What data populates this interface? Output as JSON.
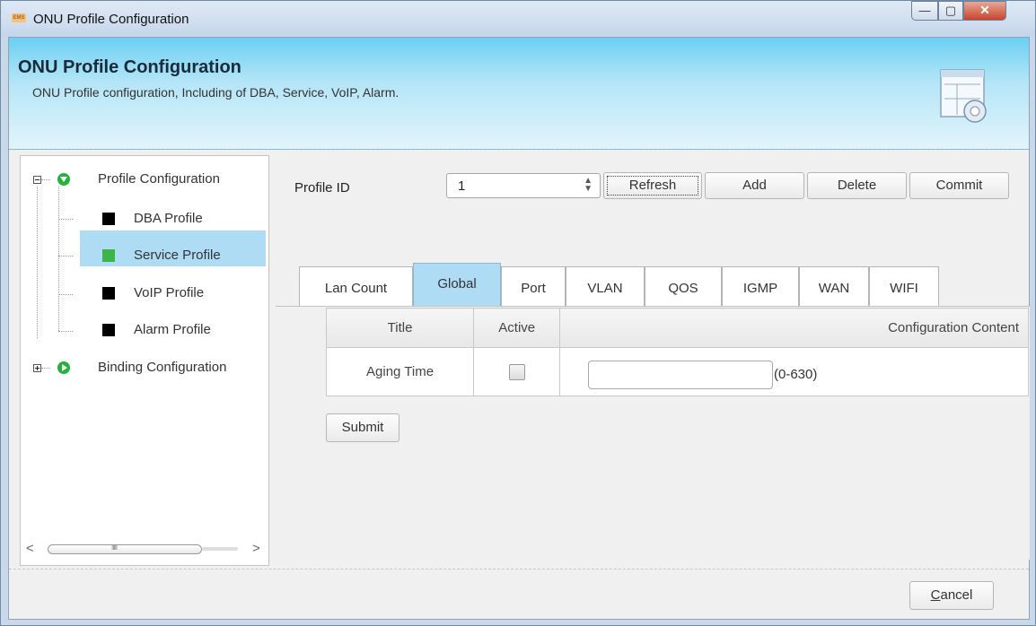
{
  "window": {
    "app_icon_text": "EMS",
    "title": "ONU Profile Configuration",
    "controls": {
      "minimize": "—",
      "maximize": "▢",
      "close": "✕"
    }
  },
  "banner": {
    "title": "ONU Profile Configuration",
    "subtitle": "ONU Profile configuration, Including of DBA, Service, VoIP, Alarm.",
    "icon": "settings-window-icon"
  },
  "tree": {
    "root": {
      "label": "Profile Configuration",
      "expanded": true
    },
    "children": [
      {
        "label": "DBA Profile",
        "color": "#000000"
      },
      {
        "label": "Service Profile",
        "color": "#3cb44a",
        "selected": true
      },
      {
        "label": "VoIP Profile",
        "color": "#000000"
      },
      {
        "label": "Alarm Profile",
        "color": "#000000"
      }
    ],
    "binding": {
      "label": "Binding Configuration",
      "expanded": false
    },
    "scrollbar": {
      "left": "<",
      "right": ">",
      "grip": "IIIII"
    }
  },
  "toolbar": {
    "profile_id_label": "Profile ID",
    "profile_id_value": "1",
    "spin_up": "▲",
    "spin_down": "▼",
    "refresh": "Refresh",
    "add": "Add",
    "delete": "Delete",
    "commit": "Commit"
  },
  "tabs": [
    "Lan Count",
    "Global",
    "Port",
    "VLAN",
    "QOS",
    "IGMP",
    "WAN",
    "WIFI"
  ],
  "active_tab": "Global",
  "grid": {
    "headers": {
      "title": "Title",
      "active": "Active",
      "content": "Configuration Content"
    },
    "row": {
      "title": "Aging Time",
      "active": false,
      "value": "",
      "range": "(0-630)"
    }
  },
  "submit": "Submit",
  "cancel": "Cancel",
  "colors": {
    "selection": "#aedcf5",
    "banner": "#6bcff2",
    "green": "#26b13c"
  }
}
